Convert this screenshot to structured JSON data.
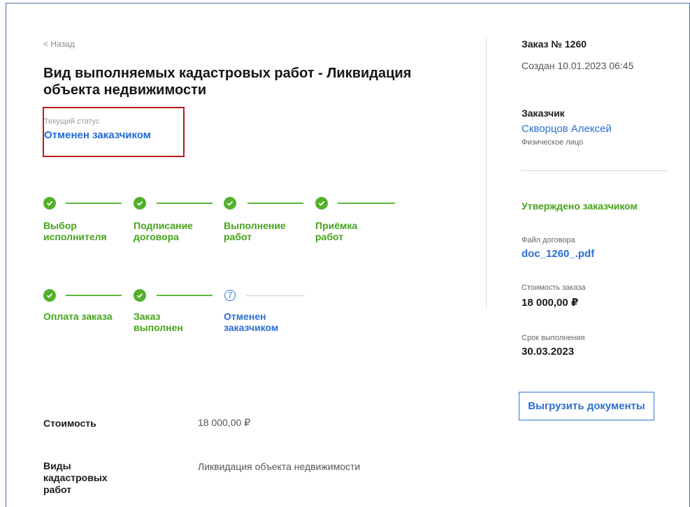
{
  "back_label": "< Назад",
  "title": "Вид выполняемых кадастровых работ - Ликвидация объекта недвижимости",
  "status": {
    "label": "Текущий статус",
    "value": "Отменен заказчиком"
  },
  "steps_row1": [
    {
      "label_line1": "Выбор",
      "label_line2": "исполнителя",
      "state": "done"
    },
    {
      "label_line1": "Подписание",
      "label_line2": "договора",
      "state": "done"
    },
    {
      "label_line1": "Выполнение",
      "label_line2": "работ",
      "state": "done"
    },
    {
      "label_line1": "Приёмка",
      "label_line2": "работ",
      "state": "done"
    }
  ],
  "steps_row2": [
    {
      "label_line1": "Оплата заказа",
      "label_line2": "",
      "state": "done"
    },
    {
      "label_line1": "Заказ",
      "label_line2": "выполнен",
      "state": "done"
    },
    {
      "label_line1": "Отменен",
      "label_line2": "заказчиком",
      "state": "current",
      "number": "7"
    }
  ],
  "details": [
    {
      "label": "Стоимость",
      "value": "18 000,00 ₽"
    },
    {
      "label_lines": [
        "Виды",
        "кадастровых",
        "работ"
      ],
      "value": "Ликвидация объекта недвижимости"
    }
  ],
  "sidebar": {
    "order_title": "Заказ № 1260",
    "created": "Создан 10.01.2023 06:45",
    "customer_heading": "Заказчик",
    "customer_name": "Скворцов Алексей",
    "customer_type": "Физическое лицо",
    "approval_status": "Утверждено заказчиком",
    "contract_file_label": "Файл договора",
    "contract_file_name": "doc_1260_.pdf",
    "order_cost_label": "Стоимость заказа",
    "order_cost_value": "18 000,00 ₽",
    "deadline_label": "Срок выполнения",
    "deadline_value": "30.03.2023",
    "export_button": "Выгрузить документы"
  },
  "colors": {
    "accent_blue": "#2a6fd2",
    "success_green": "#45a31b",
    "highlight_red": "#c0161b"
  },
  "icons": {
    "done_step": "check-circle-icon",
    "current_step": "numbered-circle-icon"
  }
}
